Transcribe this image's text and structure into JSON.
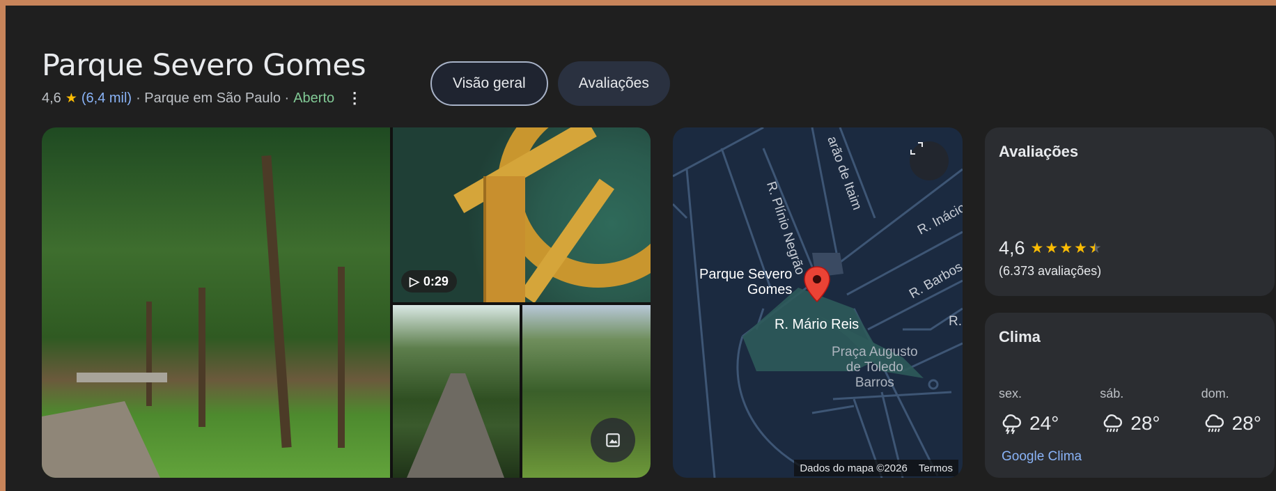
{
  "place": {
    "title": "Parque Severo Gomes",
    "rating": "4,6",
    "reviews_short": "(6,4 mil)",
    "category": "· Parque em São Paulo ·",
    "status": "Aberto"
  },
  "tabs": [
    {
      "label": "Visão geral",
      "active": true
    },
    {
      "label": "Avaliações",
      "active": false
    }
  ],
  "gallery": {
    "video_duration": "0:29"
  },
  "map": {
    "streets": [
      "R. Plínio Negrão",
      "arão de Itaim",
      "R. Inácio",
      "R. Barbos",
      "R. Mário Reis",
      "R.:"
    ],
    "park_label_line1": "Parque Severo",
    "park_label_line2": "Gomes",
    "square_line1": "Praça Augusto",
    "square_line2": "de Toledo",
    "square_line3": "Barros",
    "attribution": "Dados do mapa ©2026",
    "terms": "Termos"
  },
  "reviews_card": {
    "title": "Avaliações",
    "rating": "4,6",
    "stars": 4.6,
    "count": "(6.373 avaliações)"
  },
  "weather_card": {
    "title": "Clima",
    "days": [
      {
        "name": "sex.",
        "temp": "24°",
        "icon": "thunderstorm-icon"
      },
      {
        "name": "sáb.",
        "temp": "28°",
        "icon": "rain-icon"
      },
      {
        "name": "dom.",
        "temp": "28°",
        "icon": "rain-icon"
      }
    ],
    "link": "Google Clima"
  },
  "colors": {
    "accent_link": "#8ab4f8",
    "open_green": "#81c995",
    "star_yellow": "#fbbc04",
    "map_bg": "#1b2a40",
    "pin_red": "#ea4335"
  }
}
